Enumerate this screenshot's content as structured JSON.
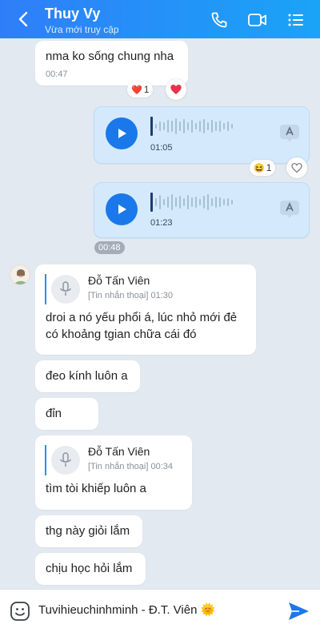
{
  "header": {
    "title": "Thuy Vy",
    "subtitle": "Vừa mới truy cập",
    "icons": [
      "back-icon",
      "phone-icon",
      "video-call-icon",
      "menu-list-icon"
    ],
    "gradient": [
      "#2f7ef9",
      "#1aa4f7"
    ]
  },
  "messages": {
    "m1": {
      "text": "nma ko sống chung nha",
      "time": "00:47",
      "reaction_count": "1",
      "reaction_emoji": "❤️"
    },
    "v1": {
      "duration": "01:05",
      "reaction_count": "1",
      "reaction_emoji": "😆"
    },
    "v2": {
      "duration": "01:23"
    },
    "time_separator": "00:48",
    "q1": {
      "quote_name": "Đỗ Tấn Viên",
      "quote_sub": "[Tin nhắn thoại] 01:30",
      "line1": "droi a nó yếu phổi á, lúc nhỏ mới đẻ",
      "line2": "có khoảng tgian chữa cái đó"
    },
    "m2": {
      "text": "đeo kính luôn a"
    },
    "m3": {
      "text": "đỉn"
    },
    "q2": {
      "quote_name": "Đỗ Tấn Viên",
      "quote_sub": "[Tin nhắn thoại] 00:34",
      "text": "tìm tòi khiếp luôn a"
    },
    "m4": {
      "text": "thg này giỏi lắm"
    },
    "m5": {
      "text": "chịu học hỏi lắm"
    }
  },
  "input": {
    "value": "Tuvihieuchinhminh - Đ.T. Viên 🌞",
    "icons": [
      "emoji-icon",
      "send-icon"
    ]
  },
  "colors": {
    "accent": "#1b78ea",
    "sent_bubble": "#d4eafc",
    "background": "#e2e9f1"
  }
}
